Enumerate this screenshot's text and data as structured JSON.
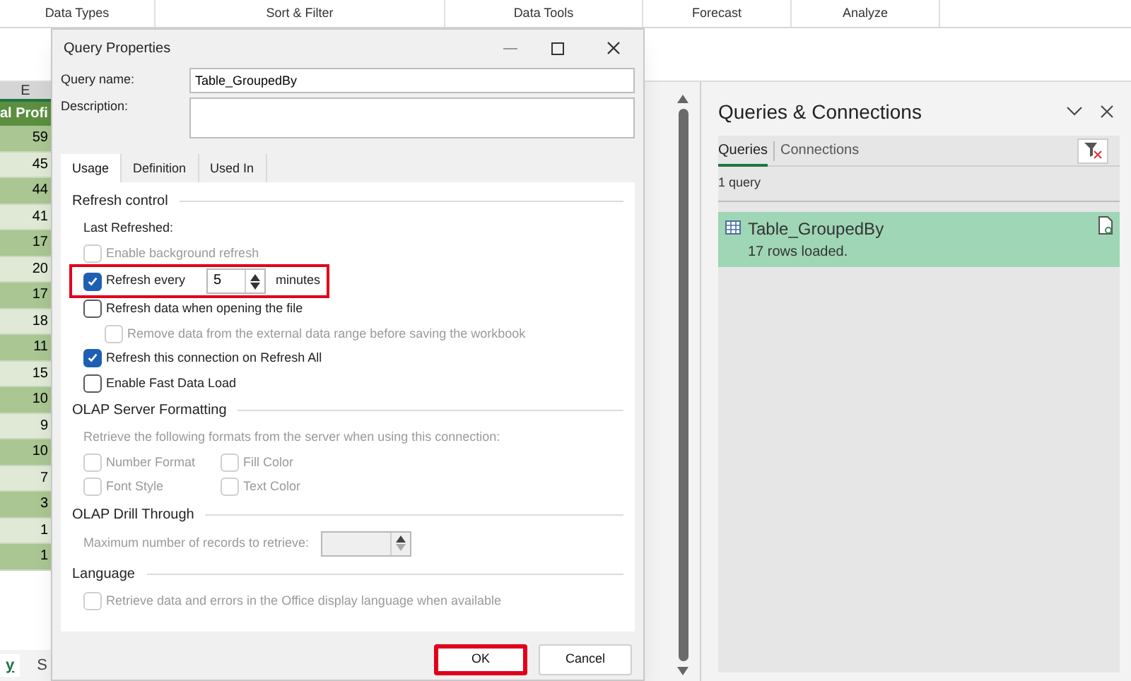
{
  "ribbon": {
    "groups": [
      "Data Types",
      "Sort & Filter",
      "Data Tools",
      "Forecast",
      "Analyze"
    ]
  },
  "sheet": {
    "column_header": "E",
    "header_cell": "al Profi",
    "cells": [
      "59",
      "45",
      "44",
      "41",
      "17",
      "20",
      "17",
      "18",
      "11",
      "15",
      "10",
      "9",
      "10",
      "7",
      "3",
      "1",
      "1"
    ],
    "tabs": [
      {
        "label": "y",
        "selected": true
      },
      {
        "label": "S",
        "selected": false
      }
    ]
  },
  "dialog": {
    "title": "Query Properties",
    "query_name": {
      "label": "Query name:",
      "value": "Table_GroupedBy"
    },
    "description": {
      "label": "Description:"
    },
    "tabs": [
      {
        "label": "Usage",
        "selected": true
      },
      {
        "label": "Definition",
        "selected": false
      },
      {
        "label": "Used In",
        "selected": false
      }
    ],
    "refresh_control": {
      "heading": "Refresh control",
      "last_refreshed": "Last Refreshed:",
      "options": [
        {
          "kind": "checkbox",
          "label": "Enable background refresh",
          "checked": false,
          "disabled": true,
          "indented": false,
          "highlighted": false
        },
        {
          "kind": "interval",
          "label": "Refresh every",
          "value": "5",
          "unit": "minutes",
          "checked": true,
          "disabled": false,
          "indented": false,
          "highlighted": true
        },
        {
          "kind": "checkbox",
          "label": "Refresh data when opening the file",
          "checked": false,
          "disabled": false,
          "indented": false,
          "highlighted": false
        },
        {
          "kind": "checkbox",
          "label": "Remove data from the external data range before saving the workbook",
          "checked": false,
          "disabled": true,
          "indented": true,
          "highlighted": false
        },
        {
          "kind": "checkbox",
          "label": "Refresh this connection on Refresh All",
          "checked": true,
          "disabled": false,
          "indented": false,
          "highlighted": false
        },
        {
          "kind": "checkbox",
          "label": "Enable Fast Data Load",
          "checked": false,
          "disabled": false,
          "indented": false,
          "highlighted": false
        }
      ]
    },
    "olap_formatting": {
      "heading": "OLAP Server Formatting",
      "note": "Retrieve the following formats from the server when using this connection:",
      "options": [
        {
          "label": "Number Format",
          "checked": false,
          "disabled": true
        },
        {
          "label": "Fill Color",
          "checked": false,
          "disabled": true
        },
        {
          "label": "Font Style",
          "checked": false,
          "disabled": true
        },
        {
          "label": "Text Color",
          "checked": false,
          "disabled": true
        }
      ]
    },
    "olap_drill": {
      "heading": "OLAP Drill Through",
      "label": "Maximum number of records to retrieve:",
      "disabled": true
    },
    "language": {
      "heading": "Language",
      "option": {
        "label": "Retrieve data and errors in the Office display language when available",
        "checked": false,
        "disabled": true
      }
    },
    "buttons": [
      {
        "label": "OK",
        "highlighted": true
      },
      {
        "label": "Cancel",
        "highlighted": false
      }
    ]
  },
  "panel": {
    "title": "Queries & Connections",
    "tabs": [
      {
        "label": "Queries",
        "selected": true
      },
      {
        "label": "Connections",
        "selected": false
      }
    ],
    "count": "1 query",
    "items": [
      {
        "name": "Table_GroupedBy",
        "status": "17 rows loaded.",
        "selected": true
      }
    ]
  }
}
